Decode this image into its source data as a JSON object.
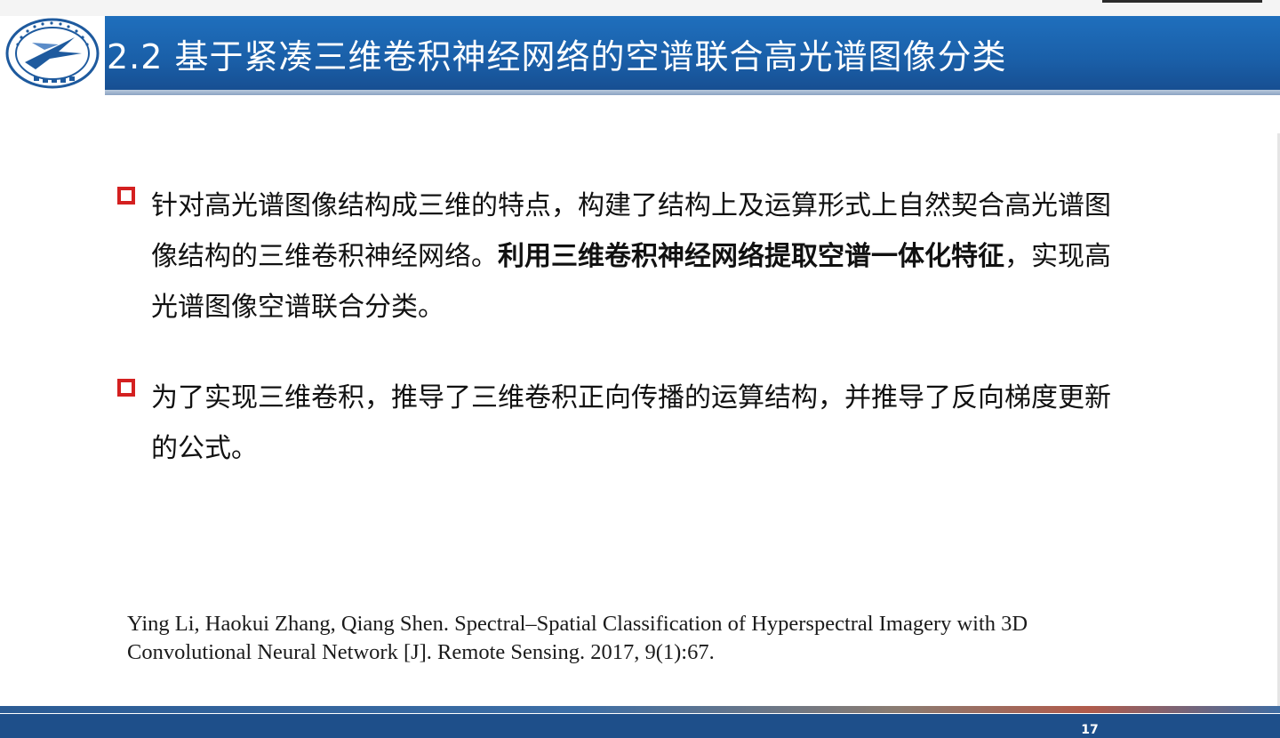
{
  "header": {
    "title": "2.2 基于紧凑三维卷积神经网络的空谱联合高光谱图像分类"
  },
  "logo": {
    "ring_text_top": "NORTHWESTERN POLYTECHNICAL UNIVERSITY",
    "ring_text_bottom": "西北工业大学",
    "icon": "university-seal"
  },
  "bullets": [
    {
      "icon": "square-bullet-icon",
      "text_before": "针对高光谱图像结构成三维的特点，构建了结构上及运算形式上自然契合高光谱图像结构的三维卷积神经网络。",
      "text_bold": "利用三维卷积神经网络提取空谱一体化特征",
      "text_after": "，实现高光谱图像空谱联合分类。"
    },
    {
      "icon": "square-bullet-icon",
      "text_before": "为了实现三维卷积，推导了三维卷积正向传播的运算结构，并推导了反向梯度更新的公式。"
    }
  ],
  "reference": "Ying Li, Haokui Zhang, Qiang Shen. Spectral–Spatial Classification of Hyperspectral Imagery with 3D Convolutional Neural Network [J]. Remote Sensing. 2017, 9(1):67.",
  "footer": {
    "page_number": "17"
  },
  "colors": {
    "header_blue": "#1a5fa8",
    "bullet_red": "#d42020",
    "footer_blue": "#1e4f8a"
  }
}
